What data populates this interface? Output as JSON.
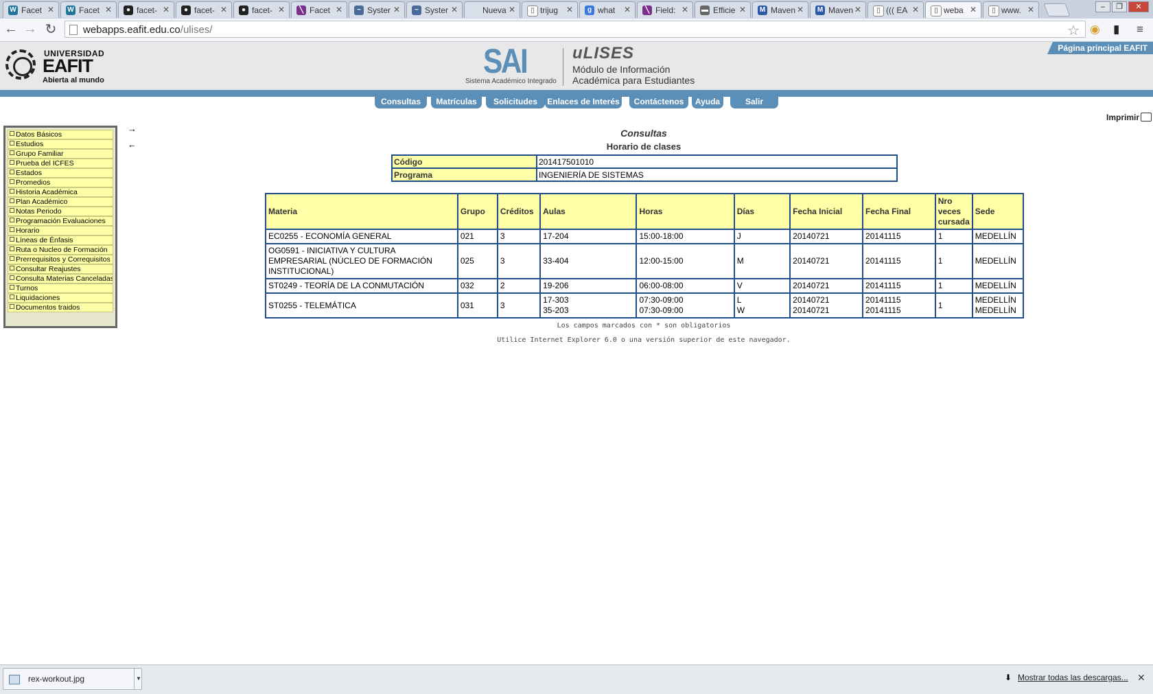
{
  "browser": {
    "tabs": [
      {
        "title": "Facet",
        "icon": "wordpress-icon",
        "color": "#21759b",
        "glyph": "W"
      },
      {
        "title": "Facet",
        "icon": "wordpress-icon",
        "color": "#21759b",
        "glyph": "W"
      },
      {
        "title": "facet-",
        "icon": "github-icon",
        "color": "#222222",
        "glyph": "●"
      },
      {
        "title": "facet-",
        "icon": "github-icon",
        "color": "#222222",
        "glyph": "●"
      },
      {
        "title": "facet-",
        "icon": "github-icon",
        "color": "#222222",
        "glyph": "●"
      },
      {
        "title": "Facet",
        "icon": "feather-icon",
        "color": "#7a2f8a",
        "glyph": "╲"
      },
      {
        "title": "Syster",
        "icon": "wave-icon",
        "color": "#4a6a9a",
        "glyph": "~"
      },
      {
        "title": "Syster",
        "icon": "wave-icon",
        "color": "#4a6a9a",
        "glyph": "~"
      },
      {
        "title": "Nueva p",
        "icon": "",
        "color": "#d9dfe9",
        "glyph": ""
      },
      {
        "title": "trijug",
        "icon": "document-icon",
        "color": "#ffffff",
        "glyph": "▯"
      },
      {
        "title": "what",
        "icon": "google-icon",
        "color": "#3a78e0",
        "glyph": "g"
      },
      {
        "title": "Field:",
        "icon": "feather-icon",
        "color": "#7a2f8a",
        "glyph": "╲"
      },
      {
        "title": "Efficie",
        "icon": "globe-icon",
        "color": "#666666",
        "glyph": "▬"
      },
      {
        "title": "Maven",
        "icon": "maven-icon",
        "color": "#2a5aa8",
        "glyph": "M"
      },
      {
        "title": "Maven",
        "icon": "maven-icon",
        "color": "#2a5aa8",
        "glyph": "M"
      },
      {
        "title": "((( EA",
        "icon": "document-icon",
        "color": "#ffffff",
        "glyph": "▯"
      },
      {
        "title": "weba",
        "icon": "document-icon",
        "color": "#ffffff",
        "glyph": "▯"
      },
      {
        "title": "www.",
        "icon": "document-icon",
        "color": "#ffffff",
        "glyph": "▯"
      }
    ],
    "window_buttons": [
      "–",
      "❐",
      "✕"
    ],
    "url_host": "webapps.eafit.edu.co",
    "url_path": "/ulises/"
  },
  "header": {
    "logo_line1": "UNIVERSIDAD",
    "logo_line2": "EAFIT",
    "logo_line3": "Abierta al mundo",
    "sai": "SAI",
    "sai_sub": "Sistema Académico Integrado",
    "ulises": "uLISES",
    "ulises_sub1": "Módulo de Información",
    "ulises_sub2": "Académica para Estudiantes",
    "home_link": "Página principal EAFIT"
  },
  "menu": [
    "Consultas",
    "Matrículas",
    "Solicitudes",
    "Enlaces de Interés",
    "Contáctenos",
    "Ayuda",
    "Salir"
  ],
  "sidebar": [
    "Datos Básicos",
    "Estudios",
    "Grupo Familiar",
    "Prueba del ICFES",
    "Estados",
    "Promedios",
    "Historia Académica",
    "Plan Académico",
    "Notas Periodo",
    "Programación Evaluaciones",
    "Horario",
    "Líneas de Énfasis",
    "Ruta o Nucleo de Formación",
    "Prerrequisitos y Correquisitos",
    "Consultar Reajustes",
    "Consulta Materias Canceladas",
    "Turnos",
    "Liquidaciones",
    "Documentos traidos"
  ],
  "arrows": {
    "expand": "→",
    "collapse": "←"
  },
  "content": {
    "print": "Imprimir",
    "title": "Consultas",
    "subtitle": "Horario de clases",
    "info": [
      {
        "label": "Código",
        "value": "201417501010"
      },
      {
        "label": "Programa",
        "value": "INGENIERÍA DE SISTEMAS"
      }
    ],
    "columns": [
      "Materia",
      "Grupo",
      "Créditos",
      "Aulas",
      "Horas",
      "Días",
      "Fecha Inicial",
      "Fecha Final",
      "Nro veces cursada",
      "Sede"
    ],
    "rows": [
      [
        "EC0255 - ECONOMÍA GENERAL",
        "021",
        "3",
        "17-204",
        "15:00-18:00",
        "J",
        "20140721",
        "20141115",
        "1",
        "MEDELLÍN"
      ],
      [
        "OG0591 - INICIATIVA Y CULTURA EMPRESARIAL (NÚCLEO DE FORMACIÓN INSTITUCIONAL)",
        "025",
        "3",
        "33-404",
        "12:00-15:00",
        "M",
        "20140721",
        "20141115",
        "1",
        "MEDELLÍN"
      ],
      [
        "ST0249 - TEORÍA DE LA CONMUTACIÓN",
        "032",
        "2",
        "19-206",
        "06:00-08:00",
        "V",
        "20140721",
        "20141115",
        "1",
        "MEDELLÍN"
      ],
      [
        "ST0255 - TELEMÁTICA",
        "031",
        "3",
        "17-303\n35-203",
        "07:30-09:00\n07:30-09:00",
        "L\nW",
        "20140721\n20140721",
        "20141115\n20141115",
        "1",
        "MEDELLÍN\nMEDELLÍN"
      ]
    ],
    "note1": "Los campos marcados con * son obligatorios",
    "note2": "Utilice Internet Explorer 6.0 o una versión superior de este navegador."
  },
  "downloads": {
    "file": "rex-workout.jpg",
    "show_all": "Mostrar todas las descargas..."
  },
  "colors": {
    "accent": "#5c8fb8",
    "cell_yellow": "#ffffa8",
    "border_blue": "#1f4e8c"
  }
}
